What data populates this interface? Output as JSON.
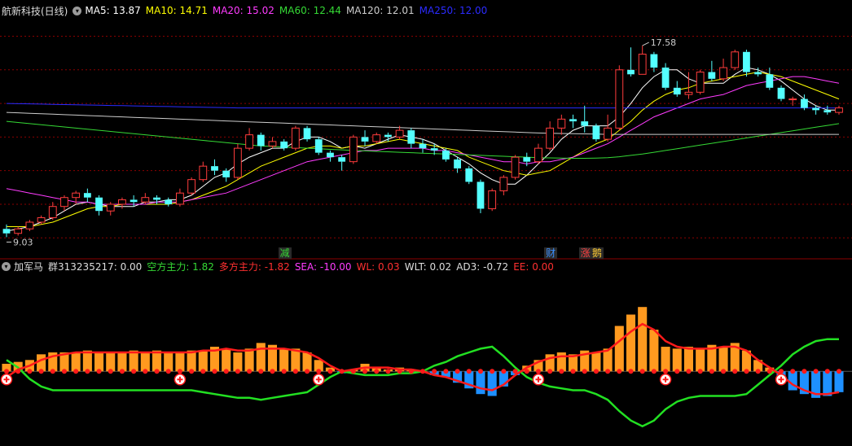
{
  "header": {
    "stock_title": "航新科技(日线)",
    "ma_items": [
      {
        "label": "MA5: 13.87",
        "color": "#ffffff"
      },
      {
        "label": "MA10: 14.71",
        "color": "#ffff00"
      },
      {
        "label": "MA20: 15.02",
        "color": "#ff3cff"
      },
      {
        "label": "MA60: 12.44",
        "color": "#35d935"
      },
      {
        "label": "MA120: 12.01",
        "color": "#cccccc"
      },
      {
        "label": "MA250: 12.00",
        "color": "#2b2bff"
      }
    ]
  },
  "indicator_header": {
    "name": "加军马",
    "items": [
      {
        "label": "群313235217: 0.00",
        "color": "#dddddd"
      },
      {
        "label": "空方主力: 1.82",
        "color": "#35d935"
      },
      {
        "label": "多方主力: -1.82",
        "color": "#ff3030"
      },
      {
        "label": "SEA: -10.00",
        "color": "#ff3cff"
      },
      {
        "label": "WL: 0.03",
        "color": "#ff3030"
      },
      {
        "label": "WLT: 0.02",
        "color": "#dddddd"
      },
      {
        "label": "AD3: -0.72",
        "color": "#dddddd"
      },
      {
        "label": "EE: 0.00",
        "color": "#ff3030"
      }
    ]
  },
  "annotations": {
    "high_label": "17.58",
    "low_label": "9.03"
  },
  "event_markers": [
    {
      "text": "减",
      "color": "#35d935",
      "bg": "#2a2a2a",
      "index": 24
    },
    {
      "text": "财",
      "color": "#3a8fff",
      "bg": "#2a2a2a",
      "index": 47
    },
    {
      "text": "涨",
      "color": "#ff4040",
      "bg": "#2a2a2a",
      "index": 50
    },
    {
      "text": "鹅",
      "color": "#ffcc33",
      "bg": "#2a2a2a",
      "index": 51
    }
  ],
  "colors": {
    "up": "#ff3c3c",
    "down": "#54ffff",
    "grid": "#8b0000",
    "ma5": "#ffffff",
    "ma10": "#ffff00",
    "ma20": "#ff3cff",
    "ma60": "#35d935",
    "ma120": "#cccccc",
    "ma250": "#2b2bff",
    "hist_pos": "#ff9a1f",
    "hist_neg": "#1e90ff",
    "line_green": "#22e022",
    "line_red": "#ff1a1a"
  },
  "chart_data": {
    "type": "candlestick",
    "y_range": [
      8.5,
      18.6
    ],
    "candles": [
      [
        9.4,
        9.2,
        9.6,
        9.03
      ],
      [
        9.2,
        9.4,
        9.5,
        9.1
      ],
      [
        9.4,
        9.7,
        9.8,
        9.3
      ],
      [
        9.7,
        9.9,
        10.0,
        9.6
      ],
      [
        9.9,
        10.4,
        10.6,
        9.8
      ],
      [
        10.4,
        10.8,
        10.9,
        10.2
      ],
      [
        10.8,
        11.0,
        11.1,
        10.5
      ],
      [
        11.0,
        10.8,
        11.2,
        10.6
      ],
      [
        10.8,
        10.2,
        10.9,
        10.0
      ],
      [
        10.2,
        10.5,
        10.6,
        10.0
      ],
      [
        10.5,
        10.7,
        10.8,
        10.3
      ],
      [
        10.7,
        10.6,
        10.9,
        10.4
      ],
      [
        10.6,
        10.8,
        11.0,
        10.5
      ],
      [
        10.8,
        10.7,
        10.9,
        10.5
      ],
      [
        10.7,
        10.5,
        10.8,
        10.4
      ],
      [
        10.5,
        11.0,
        11.2,
        10.4
      ],
      [
        11.0,
        11.6,
        11.7,
        10.9
      ],
      [
        11.6,
        12.2,
        12.4,
        11.5
      ],
      [
        12.2,
        12.0,
        12.5,
        11.8
      ],
      [
        12.0,
        11.7,
        12.1,
        11.5
      ],
      [
        11.7,
        13.0,
        13.2,
        11.6
      ],
      [
        13.0,
        13.6,
        13.9,
        12.9
      ],
      [
        13.6,
        13.1,
        13.7,
        12.9
      ],
      [
        13.1,
        13.3,
        13.5,
        13.0
      ],
      [
        13.3,
        13.0,
        13.4,
        12.9
      ],
      [
        13.0,
        13.9,
        14.0,
        12.9
      ],
      [
        13.9,
        13.4,
        14.0,
        13.3
      ],
      [
        13.4,
        12.8,
        13.5,
        12.7
      ],
      [
        12.8,
        12.6,
        12.9,
        12.4
      ],
      [
        12.6,
        12.4,
        12.7,
        12.0
      ],
      [
        12.4,
        13.5,
        13.6,
        12.3
      ],
      [
        13.5,
        13.3,
        13.8,
        13.1
      ],
      [
        13.3,
        13.6,
        13.7,
        13.2
      ],
      [
        13.6,
        13.5,
        13.7,
        13.3
      ],
      [
        13.5,
        13.8,
        14.0,
        13.4
      ],
      [
        13.8,
        13.2,
        13.9,
        13.0
      ],
      [
        13.2,
        13.0,
        13.4,
        12.8
      ],
      [
        13.0,
        12.9,
        13.2,
        12.7
      ],
      [
        12.9,
        12.5,
        13.0,
        12.4
      ],
      [
        12.5,
        12.1,
        12.6,
        11.9
      ],
      [
        12.1,
        11.5,
        12.2,
        11.4
      ],
      [
        11.5,
        10.3,
        11.6,
        10.1
      ],
      [
        10.3,
        11.1,
        11.2,
        10.2
      ],
      [
        11.1,
        11.7,
        11.8,
        10.9
      ],
      [
        11.7,
        12.6,
        12.7,
        11.6
      ],
      [
        12.6,
        12.4,
        12.8,
        12.2
      ],
      [
        12.4,
        13.0,
        13.2,
        12.3
      ],
      [
        13.0,
        13.9,
        14.2,
        12.9
      ],
      [
        13.9,
        14.3,
        14.5,
        13.6
      ],
      [
        14.3,
        14.2,
        14.5,
        13.9
      ],
      [
        14.2,
        14.0,
        14.9,
        13.7
      ],
      [
        14.0,
        13.4,
        14.1,
        13.3
      ],
      [
        13.4,
        13.9,
        14.5,
        13.3
      ],
      [
        13.9,
        16.5,
        16.7,
        13.8
      ],
      [
        16.5,
        16.3,
        17.5,
        16.2
      ],
      [
        16.3,
        17.2,
        17.58,
        16.3
      ],
      [
        17.2,
        16.6,
        17.3,
        16.4
      ],
      [
        16.6,
        15.7,
        16.8,
        15.6
      ],
      [
        15.7,
        15.4,
        16.0,
        15.3
      ],
      [
        15.4,
        15.5,
        16.4,
        15.2
      ],
      [
        15.5,
        16.4,
        16.5,
        15.4
      ],
      [
        16.4,
        16.1,
        16.9,
        16.0
      ],
      [
        16.1,
        16.6,
        17.0,
        16.0
      ],
      [
        16.6,
        17.3,
        17.4,
        16.5
      ],
      [
        17.3,
        16.4,
        17.4,
        16.2
      ],
      [
        16.4,
        16.3,
        16.6,
        16.2
      ],
      [
        16.3,
        15.7,
        16.6,
        15.6
      ],
      [
        15.7,
        15.2,
        15.8,
        15.1
      ],
      [
        15.2,
        15.2,
        15.3,
        14.9
      ],
      [
        15.2,
        14.8,
        15.4,
        14.7
      ],
      [
        14.8,
        14.7,
        14.9,
        14.5
      ],
      [
        14.7,
        14.6,
        14.9,
        14.5
      ],
      [
        14.6,
        14.8,
        14.9,
        14.5
      ]
    ],
    "series": [
      {
        "name": "MA5",
        "key": "ma5",
        "values": [
          9.3,
          9.4,
          9.5,
          9.7,
          9.9,
          10.2,
          10.5,
          10.6,
          10.5,
          10.4,
          10.4,
          10.4,
          10.6,
          10.6,
          10.7,
          10.7,
          10.9,
          11.3,
          11.7,
          11.9,
          12.3,
          12.6,
          12.8,
          13.0,
          13.0,
          13.3,
          13.5,
          13.5,
          13.3,
          13.0,
          13.1,
          13.0,
          13.2,
          13.4,
          13.6,
          13.5,
          13.4,
          13.2,
          12.9,
          12.6,
          12.3,
          11.9,
          11.6,
          11.4,
          11.4,
          11.8,
          12.3,
          12.8,
          13.4,
          13.8,
          14.0,
          14.0,
          14.0,
          14.4,
          15.0,
          15.7,
          16.2,
          16.5,
          16.5,
          16.1,
          15.9,
          15.9,
          15.9,
          16.3,
          16.6,
          16.5,
          16.3,
          16.0,
          15.6,
          15.2,
          14.9,
          14.7,
          14.7
        ]
      },
      {
        "name": "MA10",
        "key": "ma10",
        "values": [
          9.5,
          9.5,
          9.5,
          9.6,
          9.7,
          9.9,
          10.1,
          10.3,
          10.4,
          10.4,
          10.5,
          10.5,
          10.5,
          10.5,
          10.5,
          10.6,
          10.7,
          10.9,
          11.1,
          11.3,
          11.6,
          11.9,
          12.2,
          12.4,
          12.6,
          12.8,
          13.0,
          13.1,
          13.1,
          13.0,
          13.1,
          13.1,
          13.2,
          13.3,
          13.4,
          13.3,
          13.2,
          13.1,
          13.0,
          12.9,
          12.6,
          12.4,
          12.2,
          12.0,
          11.9,
          11.8,
          11.9,
          12.0,
          12.3,
          12.6,
          12.9,
          13.2,
          13.4,
          13.8,
          14.2,
          14.7,
          15.1,
          15.4,
          15.6,
          15.7,
          15.9,
          16.0,
          16.1,
          16.2,
          16.3,
          16.4,
          16.3,
          16.2,
          16.0,
          15.8,
          15.6,
          15.4,
          15.2
        ]
      },
      {
        "name": "MA20",
        "key": "ma20",
        "values": [
          11.2,
          11.1,
          11.0,
          10.9,
          10.8,
          10.7,
          10.6,
          10.6,
          10.5,
          10.5,
          10.5,
          10.5,
          10.5,
          10.6,
          10.6,
          10.6,
          10.7,
          10.8,
          10.9,
          11.0,
          11.2,
          11.4,
          11.6,
          11.8,
          12.0,
          12.2,
          12.4,
          12.5,
          12.6,
          12.7,
          12.8,
          12.9,
          12.9,
          13.0,
          13.0,
          13.0,
          13.0,
          12.9,
          12.9,
          12.8,
          12.7,
          12.6,
          12.5,
          12.4,
          12.4,
          12.3,
          12.4,
          12.4,
          12.5,
          12.6,
          12.8,
          13.0,
          13.2,
          13.5,
          13.8,
          14.1,
          14.4,
          14.6,
          14.8,
          15.0,
          15.2,
          15.3,
          15.4,
          15.6,
          15.8,
          15.9,
          16.0,
          16.1,
          16.2,
          16.2,
          16.1,
          16.0,
          15.9
        ]
      },
      {
        "name": "MA60",
        "key": "ma60",
        "values": [
          14.2,
          14.15,
          14.1,
          14.05,
          14.0,
          13.95,
          13.9,
          13.85,
          13.8,
          13.75,
          13.7,
          13.65,
          13.6,
          13.55,
          13.5,
          13.45,
          13.4,
          13.35,
          13.3,
          13.25,
          13.2,
          13.15,
          13.1,
          13.08,
          13.05,
          13.03,
          13.0,
          12.98,
          12.95,
          12.93,
          12.9,
          12.88,
          12.86,
          12.84,
          12.82,
          12.8,
          12.78,
          12.76,
          12.74,
          12.72,
          12.7,
          12.68,
          12.66,
          12.64,
          12.62,
          12.6,
          12.58,
          12.57,
          12.56,
          12.55,
          12.55,
          12.56,
          12.58,
          12.62,
          12.68,
          12.74,
          12.82,
          12.9,
          12.98,
          13.06,
          13.14,
          13.22,
          13.3,
          13.38,
          13.46,
          13.54,
          13.62,
          13.7,
          13.78,
          13.86,
          13.94,
          14.02,
          14.1
        ]
      },
      {
        "name": "MA120",
        "key": "ma120",
        "values": [
          14.6,
          14.58,
          14.56,
          14.54,
          14.52,
          14.5,
          14.48,
          14.46,
          14.44,
          14.42,
          14.4,
          14.38,
          14.36,
          14.34,
          14.32,
          14.3,
          14.28,
          14.26,
          14.24,
          14.22,
          14.2,
          14.18,
          14.16,
          14.14,
          14.12,
          14.1,
          14.08,
          14.06,
          14.04,
          14.02,
          14.0,
          13.98,
          13.96,
          13.94,
          13.92,
          13.9,
          13.88,
          13.86,
          13.84,
          13.82,
          13.8,
          13.78,
          13.76,
          13.74,
          13.72,
          13.7,
          13.68,
          13.67,
          13.66,
          13.65,
          13.64,
          13.63,
          13.62,
          13.62,
          13.62,
          13.62,
          13.62,
          13.62,
          13.62,
          13.62,
          13.62,
          13.62,
          13.62,
          13.62,
          13.62,
          13.62,
          13.62,
          13.62,
          13.62,
          13.62,
          13.62,
          13.62,
          13.62
        ]
      },
      {
        "name": "MA250",
        "key": "ma250",
        "values": [
          15.0,
          14.99,
          14.98,
          14.97,
          14.96,
          14.95,
          14.94,
          14.93,
          14.92,
          14.91,
          14.9,
          14.89,
          14.88,
          14.87,
          14.86,
          14.85,
          14.84,
          14.83,
          14.82,
          14.81,
          14.8,
          14.8,
          14.8,
          14.8,
          14.8,
          14.8,
          14.8,
          14.8,
          14.8,
          14.8,
          14.8,
          14.8,
          14.8,
          14.8,
          14.8,
          14.8,
          14.8,
          14.8,
          14.8,
          14.8,
          14.8,
          14.8,
          14.8,
          14.8,
          14.8,
          14.8,
          14.8,
          14.8,
          14.8,
          14.8,
          14.8,
          14.8,
          14.8,
          14.8,
          14.8,
          14.8,
          14.8,
          14.8,
          14.8,
          14.8,
          14.8,
          14.8,
          14.8,
          14.8,
          14.8,
          14.8,
          14.8,
          14.8,
          14.8,
          14.8,
          14.8,
          14.8,
          14.8
        ]
      }
    ],
    "indicator": {
      "histogram": [
        0.4,
        0.5,
        0.6,
        0.9,
        1.0,
        1.0,
        1.0,
        1.1,
        1.0,
        1.0,
        1.0,
        1.1,
        1.0,
        1.1,
        1.0,
        1.0,
        1.1,
        1.1,
        1.3,
        1.2,
        1.0,
        1.2,
        1.5,
        1.4,
        1.2,
        1.2,
        1.0,
        0.6,
        0.2,
        -0.1,
        0.1,
        0.4,
        0.2,
        0.1,
        0.2,
        0.1,
        0.0,
        -0.2,
        -0.3,
        -0.6,
        -0.9,
        -1.2,
        -1.3,
        -0.8,
        -0.2,
        0.3,
        0.6,
        0.9,
        1.0,
        0.9,
        1.1,
        1.0,
        1.2,
        2.4,
        3.0,
        3.4,
        2.2,
        1.3,
        1.2,
        1.3,
        1.2,
        1.4,
        1.3,
        1.5,
        1.1,
        0.6,
        0.2,
        -0.3,
        -1.0,
        -1.2,
        -1.4,
        -1.3,
        -1.1
      ],
      "red_line": [
        -0.3,
        0.1,
        0.3,
        0.6,
        0.8,
        0.9,
        1.0,
        1.0,
        1.0,
        1.0,
        1.0,
        1.0,
        1.0,
        1.0,
        1.0,
        1.0,
        1.0,
        1.1,
        1.1,
        1.2,
        1.1,
        1.1,
        1.2,
        1.2,
        1.2,
        1.1,
        1.0,
        0.7,
        0.3,
        0.0,
        0.1,
        0.2,
        0.2,
        0.2,
        0.1,
        0.1,
        0.0,
        -0.2,
        -0.3,
        -0.5,
        -0.7,
        -0.9,
        -1.0,
        -0.7,
        -0.2,
        0.2,
        0.5,
        0.7,
        0.8,
        0.8,
        0.9,
        1.0,
        1.1,
        1.6,
        2.1,
        2.5,
        2.2,
        1.6,
        1.3,
        1.2,
        1.2,
        1.2,
        1.3,
        1.3,
        1.1,
        0.6,
        0.2,
        -0.2,
        -0.7,
        -1.0,
        -1.2,
        -1.2,
        -1.1
      ],
      "green_line": [
        0.6,
        0.2,
        -0.4,
        -0.8,
        -1.0,
        -1.0,
        -1.0,
        -1.0,
        -1.0,
        -1.0,
        -1.0,
        -1.0,
        -1.0,
        -1.0,
        -1.0,
        -1.0,
        -1.0,
        -1.1,
        -1.2,
        -1.3,
        -1.4,
        -1.4,
        -1.5,
        -1.4,
        -1.3,
        -1.2,
        -1.1,
        -0.7,
        -0.3,
        0.0,
        -0.1,
        -0.2,
        -0.2,
        -0.2,
        -0.1,
        -0.1,
        0.0,
        0.3,
        0.5,
        0.8,
        1.0,
        1.2,
        1.3,
        0.8,
        0.2,
        -0.3,
        -0.6,
        -0.8,
        -0.9,
        -1.0,
        -1.0,
        -1.2,
        -1.5,
        -2.1,
        -2.6,
        -2.9,
        -2.6,
        -2.0,
        -1.6,
        -1.4,
        -1.3,
        -1.3,
        -1.3,
        -1.3,
        -1.2,
        -0.7,
        -0.2,
        0.3,
        0.9,
        1.3,
        1.6,
        1.7,
        1.7
      ],
      "buy_signal_index": [
        0,
        15,
        27,
        46,
        57,
        67
      ],
      "y_range": [
        -3.6,
        5.0
      ]
    }
  }
}
